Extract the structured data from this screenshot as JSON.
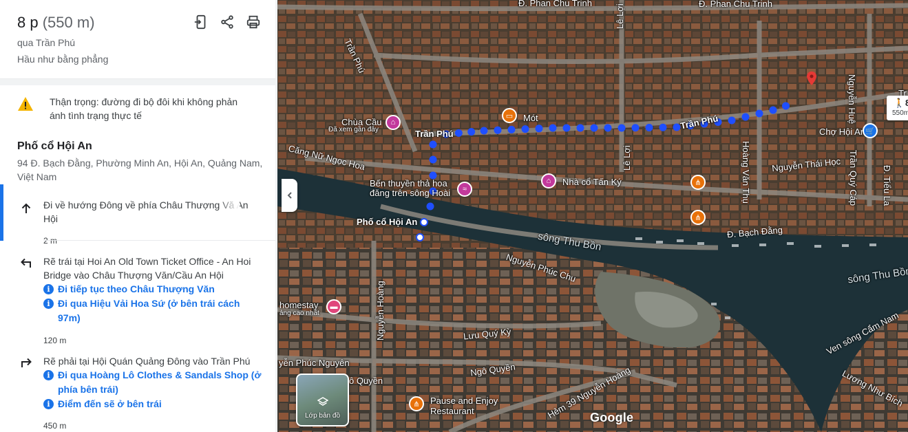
{
  "summary": {
    "duration": "8 p",
    "distance": "(550 m)",
    "via": "qua Trần Phú",
    "terrain": "Hầu như bằng phẳng",
    "icons": [
      "send-to-phone-icon",
      "share-icon",
      "print-icon"
    ]
  },
  "warning": {
    "text": "Thận trọng: đường đi bộ đôi khi không phản ánh tình trạng thực tế",
    "icon": "warning-icon"
  },
  "origin": {
    "name": "Phố cổ Hội An",
    "address": "94 Đ. Bạch Đằng, Phường Minh An, Hội An, Quảng Nam, Việt Nam"
  },
  "steps": [
    {
      "icon": "arrow-up-icon",
      "text": "Đi về hướng Đông về phía Châu Thượng Vă An Hội",
      "notes": [],
      "distance": "2 m"
    },
    {
      "icon": "turn-left-icon",
      "text": "Rẽ trái tại Hoi An Old Town Ticket Office - An Hoi Bridge vào Châu Thượng Văn/Cầu An Hội",
      "notes": [
        "Đi tiếp tục theo Châu Thượng Văn",
        "Đi qua Hiệu Vải Hoa Sứ (ở bên trái cách 97m)"
      ],
      "distance": "120 m"
    },
    {
      "icon": "turn-right-icon",
      "text": "Rẽ phải tại Hội Quán Quảng Đông vào Trần Phú",
      "notes": [
        "Đi qua Hoàng Lô Clothes & Sandals Shop (ở phía bên trái)",
        "Điểm đến sẽ ở bên trái"
      ],
      "distance": "450 m"
    }
  ],
  "map": {
    "route_badge": {
      "time": "8 p",
      "distance": "550m"
    },
    "layer_button": "Lớp bản đồ",
    "google": "Google",
    "labels": {
      "phan_chu_trinh_1": "Đ. Phan Chu Trinh",
      "phan_chu_trinh_2": "Đ. Phan Chu Trinh",
      "le_loi_1": "Lê Lợi",
      "le_loi_2": "Lê Lợi",
      "nguyen_hue": "Nguyễn Huệ",
      "tran_phu_1": "Trần Phú",
      "tran_phu_2": "Trần Phú",
      "tran_phu_3": "Trần Phú",
      "tran_phu_4": "Tr",
      "chua_cau": "Chùa Cầu",
      "chua_cau_sub": "Đã xem gần đây",
      "mot": "Mót",
      "cho_hoi_an": "Chợ Hội An",
      "cang_nu_ngoc_hoa": "Căng Nữ Ngọc Hoa",
      "ben_thuyen": "Bến thuyền thả hoa đăng trên sông Hoài",
      "nha_co": "Nhà cổ Tấn Ký",
      "nguyen_thai_hoc": "Nguyễn Thái Học",
      "hoang_van_thu": "Hoàng Văn Thụ",
      "tran_quy_cap": "Trần Quý Cáp",
      "tieu_la": "Đ. Tiểu La",
      "pho_co": "Phố cổ Hội An",
      "bach_dang": "Đ. Bạch Đằng",
      "song_thu_bon_1": "sông Thu Bồn",
      "song_thu_bon_2": "sông Thu Bồn",
      "nguyen_phuc_chu": "Nguyễn Phúc Chu",
      "homestay": "homestay",
      "homestay_sub": "ảng cao nhất",
      "nguyen_hoang": "Nguyễn Hoàng",
      "luu_quy_ky": "Lưu Quý Kỳ",
      "ngo_quyen_1": "Ngô Quyền",
      "ngo_quyen_2": "ô Quyền",
      "nguyen_phuc_nguyen": "yễn Phúc Nguyên",
      "pause_enjoy": "Pause and Enjoy Restaurant",
      "hem_39": "Hẻm 39 Nguyễn Hoàng",
      "ven_song_cam_nam": "Ven sông Cẩm Nam",
      "luong_nhu_bich": "Lương Như Bích"
    },
    "colors": {
      "route": "#1f4fff",
      "poi_pink": "#c2399c",
      "poi_orange": "#e8710a",
      "poi_blue": "#1a73e8",
      "pin_red": "#e53935",
      "river": "#1d3138"
    }
  }
}
